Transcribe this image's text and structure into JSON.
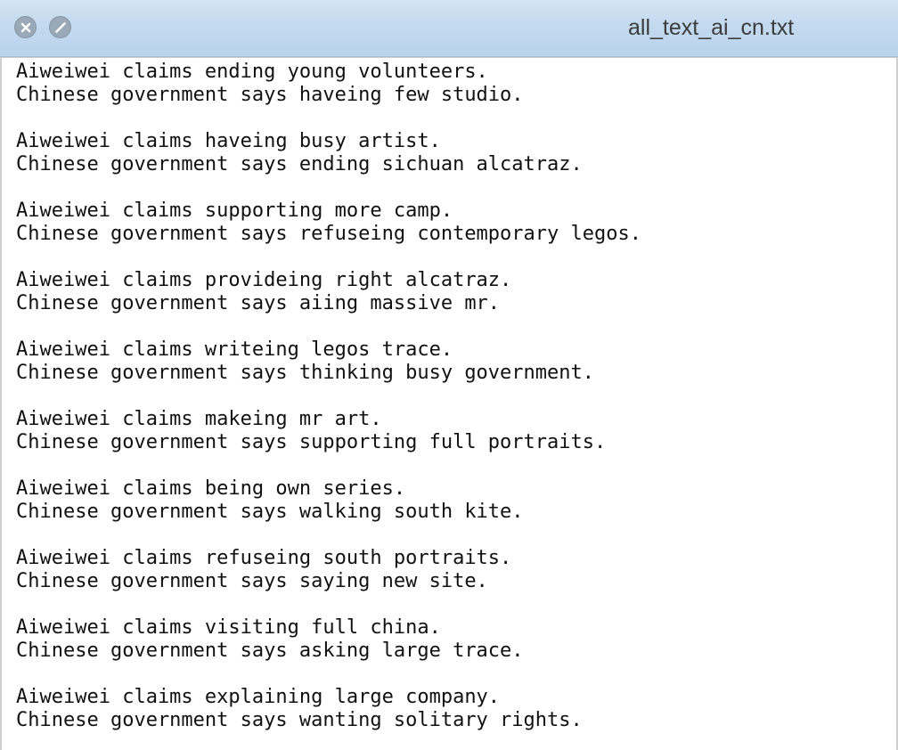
{
  "window": {
    "title": "all_text_ai_cn.txt"
  },
  "icons": {
    "close": "close-icon",
    "minimize": "minimize-icon"
  },
  "colors": {
    "titlebar": "#c4daef",
    "text": "#111111"
  },
  "document": {
    "lines": [
      "Aiweiwei claims ending young volunteers.",
      "Chinese government says haveing few studio.",
      "",
      "Aiweiwei claims haveing busy artist.",
      "Chinese government says ending sichuan alcatraz.",
      "",
      "Aiweiwei claims supporting more camp.",
      "Chinese government says refuseing contemporary legos.",
      "",
      "Aiweiwei claims provideing right alcatraz.",
      "Chinese government says aiing massive mr.",
      "",
      "Aiweiwei claims writeing legos trace.",
      "Chinese government says thinking busy government.",
      "",
      "Aiweiwei claims makeing mr art.",
      "Chinese government says supporting full portraits.",
      "",
      "Aiweiwei claims being own series.",
      "Chinese government says walking south kite.",
      "",
      "Aiweiwei claims refuseing south portraits.",
      "Chinese government says saying new site.",
      "",
      "Aiweiwei claims visiting full china.",
      "Chinese government says asking large trace.",
      "",
      "Aiweiwei claims explaining large company.",
      "Chinese government says wanting solitary rights."
    ]
  }
}
